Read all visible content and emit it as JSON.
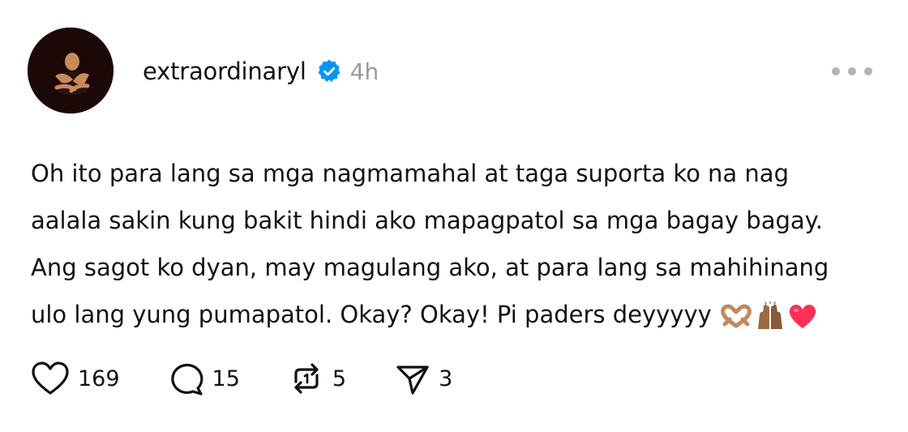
{
  "post": {
    "username": "extraordinaryl",
    "verified_icon": "verified-badge-icon",
    "time": "4h",
    "more_icon": "more-options-icon",
    "lines": [
      "Oh ito para lang sa mga nagmamahal at taga suporta ko na nag",
      "aalala sakin kung bakit hindi ako mapagpatol sa mga bagay bagay.",
      "Ang sagot ko dyan, may magulang ako, at para lang sa mahihinang",
      "ulo lang yung pumapatol. Okay? Okay! Pi paders deyyyyy"
    ],
    "emojis": [
      "heart-hands-emoji",
      "raised-hands-emoji",
      "red-heart-emoji"
    ],
    "actions": {
      "like": {
        "icon": "heart-icon",
        "count": "169"
      },
      "reply": {
        "icon": "comment-icon",
        "count": "15"
      },
      "repost": {
        "icon": "repost-icon",
        "count": "5"
      },
      "share": {
        "icon": "send-icon",
        "count": "3"
      }
    },
    "colors": {
      "verified": "#0095f6",
      "muted": "#9a9a9a",
      "heart": "#ff2f56"
    }
  }
}
